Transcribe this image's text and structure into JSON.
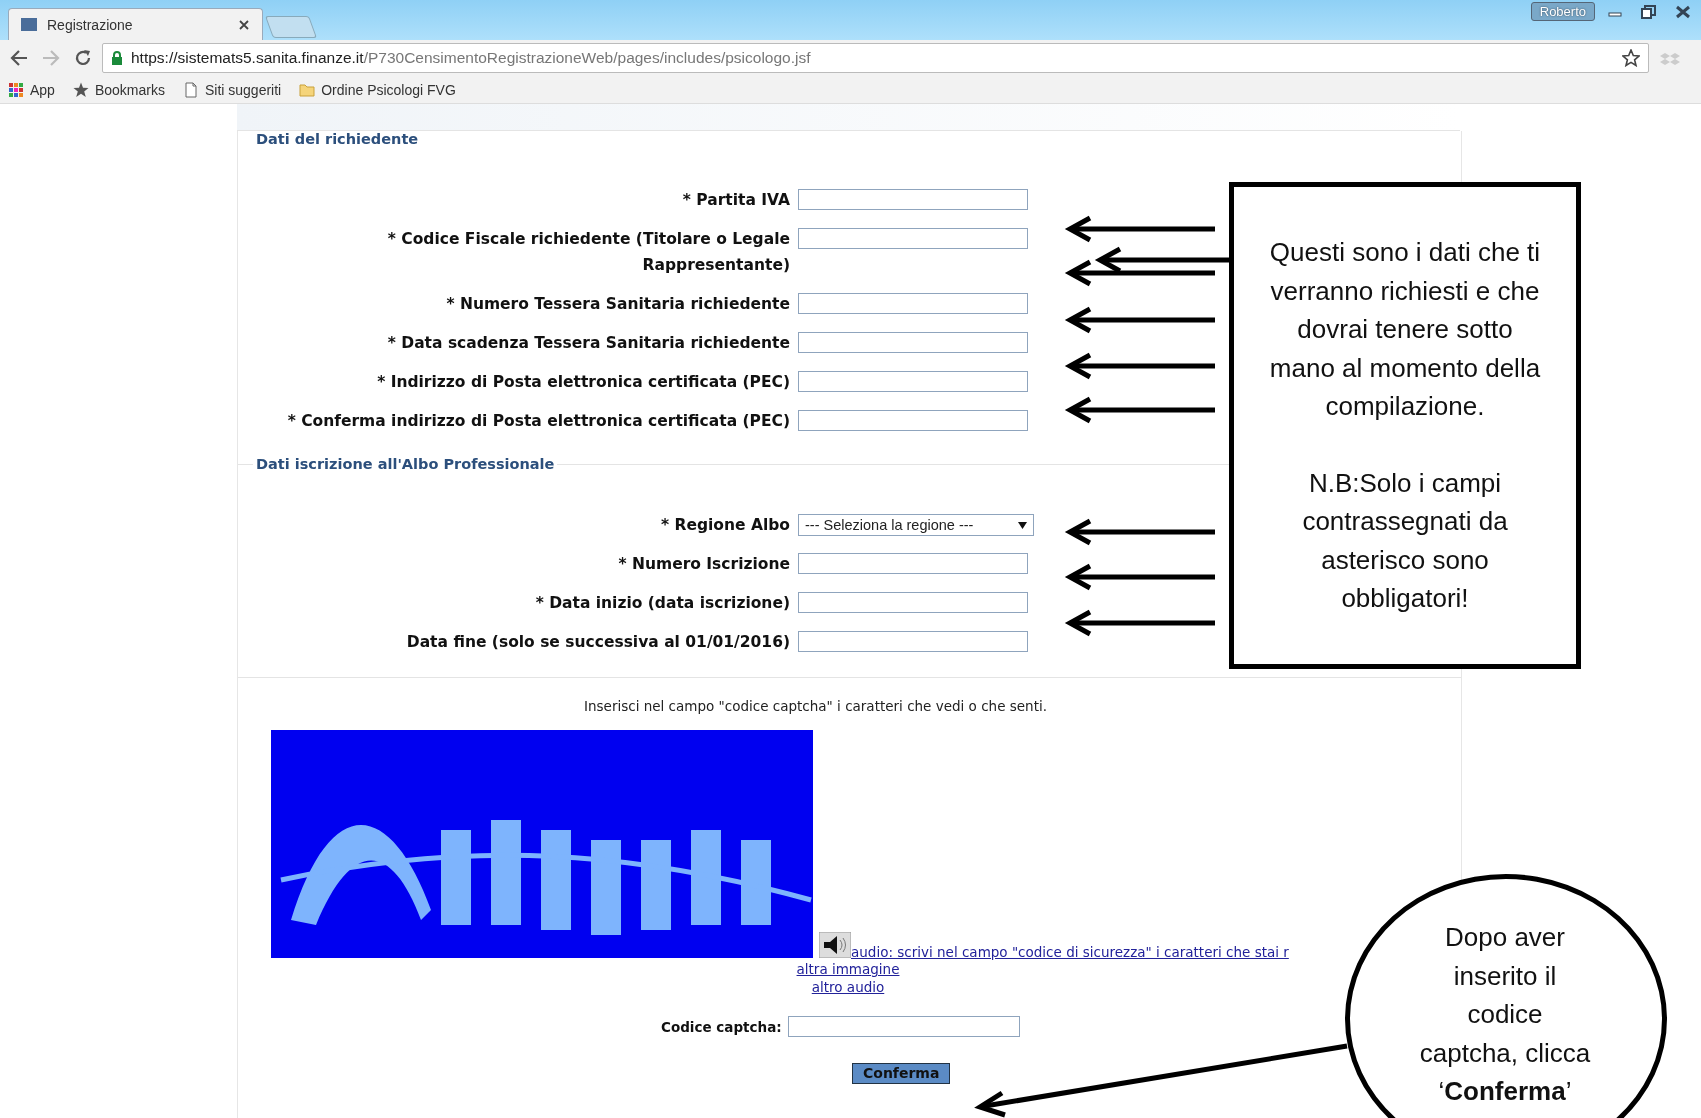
{
  "browser": {
    "tab": {
      "title": "Registrazione",
      "selected": true
    },
    "profile": "Roberto",
    "url": {
      "host": "https://sistemats5.sanita.finanze.it",
      "path": "/P730CensimentoRegistrazioneWeb/pages/includes/psicologo.jsf"
    },
    "bookmarks": [
      {
        "kind": "apps",
        "label": "App"
      },
      {
        "kind": "star",
        "label": "Bookmarks"
      },
      {
        "kind": "page",
        "label": "Siti suggeriti"
      },
      {
        "kind": "folder",
        "label": "Ordine Psicologi FVG"
      }
    ]
  },
  "form": {
    "sections": [
      {
        "legend": "Dati del richiedente",
        "fields": [
          {
            "kind": "text",
            "label": "* Partita IVA"
          },
          {
            "kind": "text",
            "label": "* Codice Fiscale richiedente (Titolare o Legale Rappresentante)"
          },
          {
            "kind": "text",
            "label": "* Numero Tessera Sanitaria richiedente"
          },
          {
            "kind": "text",
            "label": "* Data scadenza Tessera Sanitaria richiedente"
          },
          {
            "kind": "text",
            "label": "* Indirizzo di Posta elettronica certificata (PEC)"
          },
          {
            "kind": "text",
            "label": "* Conferma indirizzo di Posta elettronica certificata (PEC)"
          }
        ]
      },
      {
        "legend": "Dati iscrizione all'Albo Professionale",
        "fields": [
          {
            "kind": "select",
            "label": "* Regione Albo",
            "value": "--- Seleziona la regione ---"
          },
          {
            "kind": "text",
            "label": "* Numero Iscrizione"
          },
          {
            "kind": "text",
            "label": "* Data inizio (data iscrizione)"
          },
          {
            "kind": "text",
            "label": "Data fine (solo se successiva al 01/01/2016)"
          }
        ]
      }
    ]
  },
  "captcha": {
    "instruction": "Inserisci nel campo \"codice captcha\" i caratteri che vedi o che senti.",
    "audio_link": "audio: scrivi nel campo \"codice di sicurezza\" i caratteri che stai r",
    "links": [
      "altra immagine",
      "altro audio"
    ],
    "code_label": "Codice captcha:",
    "button": "Conferma"
  },
  "annotations": {
    "box_paragraphs": [
      "Questi sono i dati che ti verranno richiesti e che dovrai tenere sotto mano al momento della compilazione.",
      "N.B:Solo i campi contrassegnati da asterisco sono obbligatori!"
    ],
    "bubble_text": "Dopo aver inserito il codice captcha, clicca ‘**Conferma**’"
  }
}
